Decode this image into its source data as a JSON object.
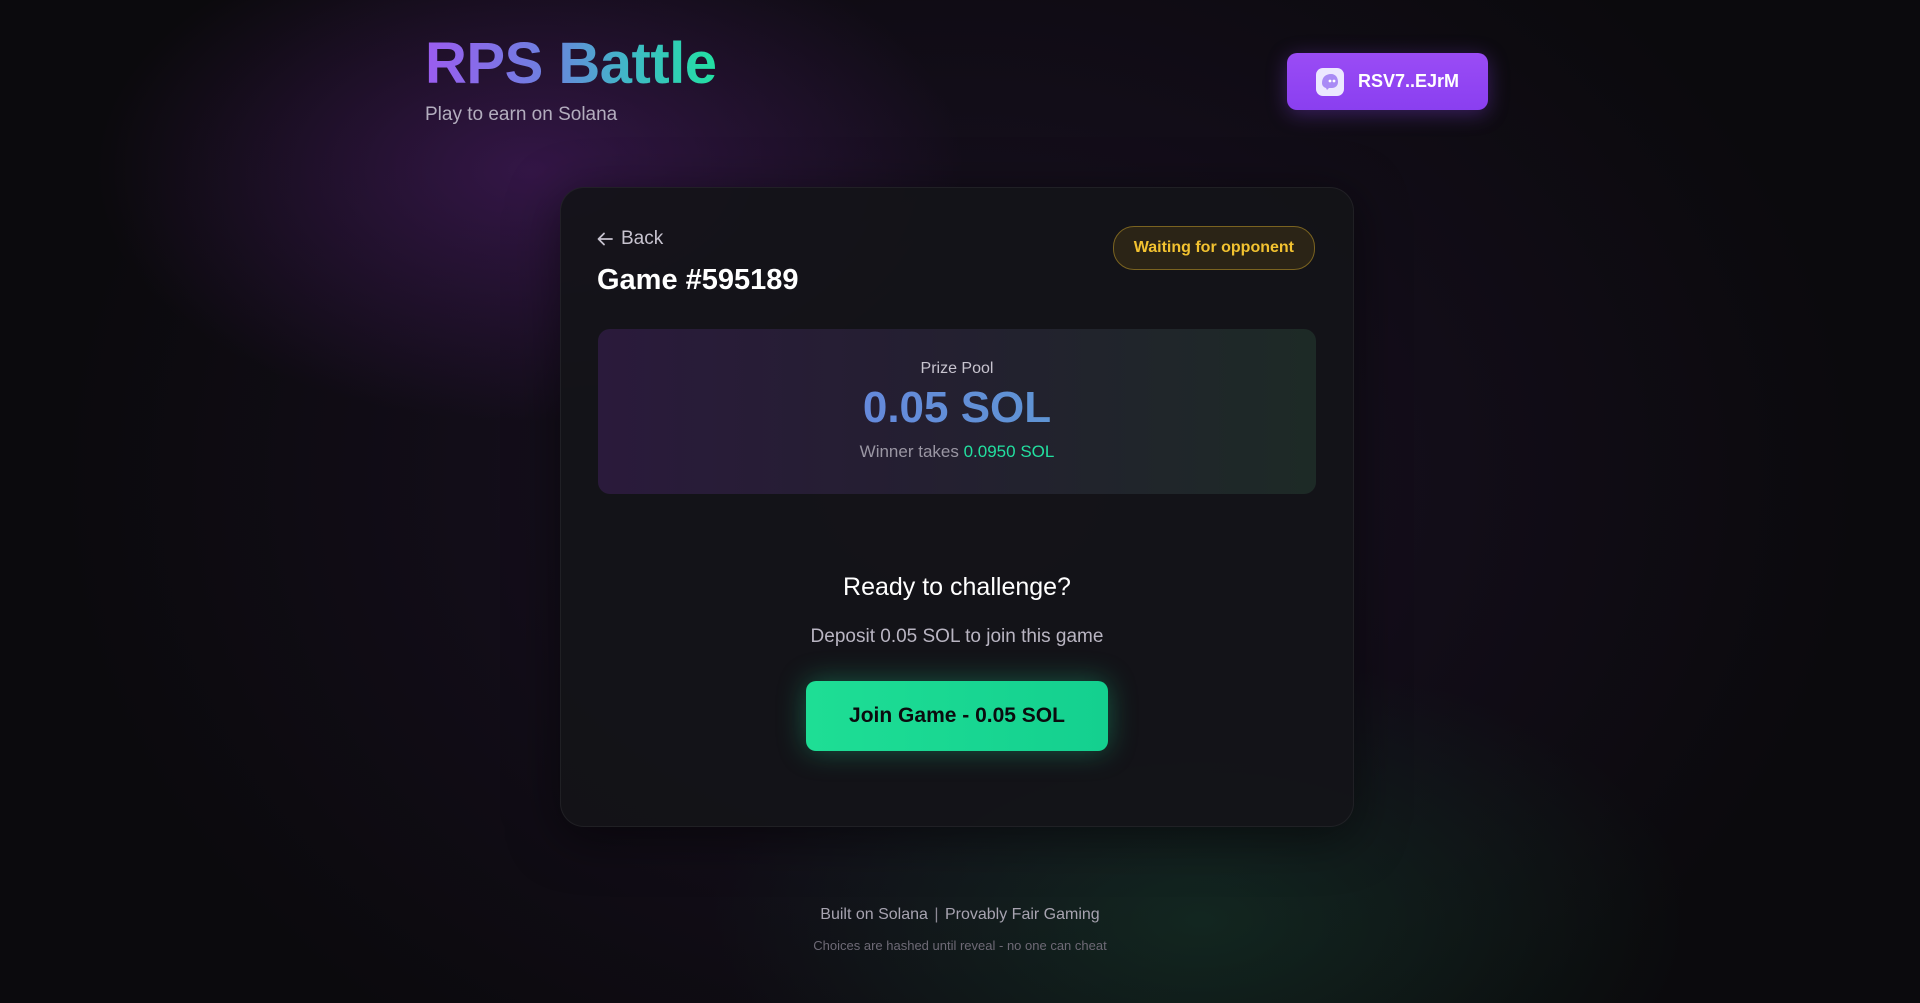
{
  "header": {
    "title": "RPS Battle",
    "subtitle": "Play to earn on Solana",
    "wallet": {
      "address": "RSV7..EJrM",
      "icon": "phantom-wallet-icon"
    }
  },
  "game": {
    "back_label": "Back",
    "title": "Game #595189",
    "status": "Waiting for opponent",
    "prize": {
      "label": "Prize Pool",
      "amount": "0.05 SOL",
      "winner_prefix": "Winner takes",
      "winner_amount": "0.0950 SOL"
    },
    "cta": {
      "heading": "Ready to challenge?",
      "description": "Deposit 0.05 SOL to join this game",
      "button_label": "Join Game - 0.05 SOL"
    }
  },
  "footer": {
    "built_on": "Built on Solana",
    "divider": "|",
    "fair": "Provably Fair Gaming",
    "note": "Choices are hashed until reveal - no one can cheat"
  },
  "colors": {
    "accent_purple": "#8a3ff0",
    "accent_green": "#1ede95",
    "status_yellow": "#f2c230"
  }
}
